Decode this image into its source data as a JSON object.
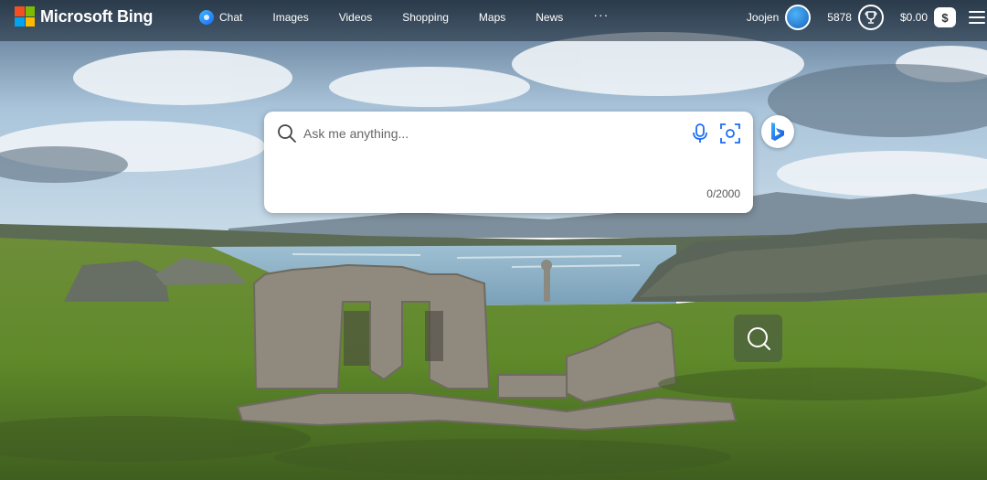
{
  "brand": {
    "name": "Microsoft Bing",
    "logo_colors": [
      "#f25022",
      "#7fba00",
      "#00a4ef",
      "#ffb900"
    ]
  },
  "nav": {
    "items": [
      {
        "label": "Chat",
        "icon": "copilot-chat-icon"
      },
      {
        "label": "Images"
      },
      {
        "label": "Videos"
      },
      {
        "label": "Shopping"
      },
      {
        "label": "Maps"
      },
      {
        "label": "News"
      }
    ],
    "more_label": "···"
  },
  "user": {
    "name": "Joojen",
    "points": "5878",
    "cash": "$0.00",
    "cash_icon_label": "$"
  },
  "search": {
    "placeholder": "Ask me anything...",
    "value": "",
    "counter": "0/2000"
  },
  "icons": {
    "search": "search-icon",
    "mic": "microphone-icon",
    "visual_search": "visual-search-icon",
    "copilot": "bing-copilot-icon",
    "menu": "hamburger-menu-icon",
    "trophy": "trophy-icon"
  },
  "colors": {
    "accent": "#1a6df5",
    "sky_top": "#2f4a63",
    "grass": "#5f8a2a",
    "sea": "#8fb3c9"
  }
}
